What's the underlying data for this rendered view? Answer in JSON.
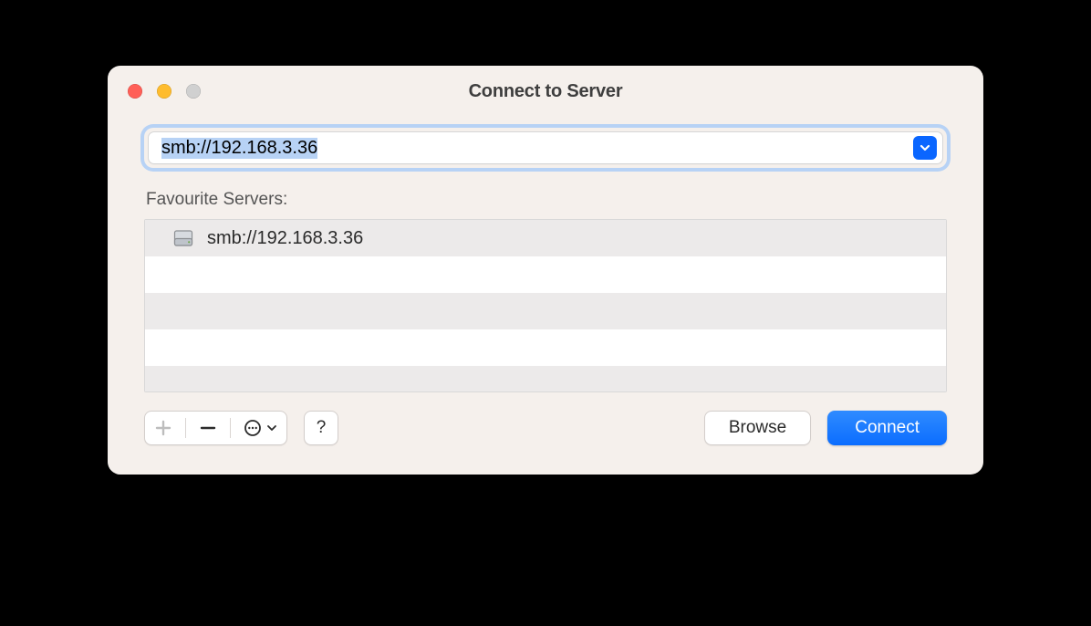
{
  "title": "Connect to Server",
  "addressField": {
    "value": "smb://192.168.3.36"
  },
  "favouritesLabel": "Favourite Servers:",
  "favourites": [
    {
      "address": "smb://192.168.3.36"
    }
  ],
  "actions": {
    "browse": "Browse",
    "connect": "Connect"
  },
  "help": "?"
}
